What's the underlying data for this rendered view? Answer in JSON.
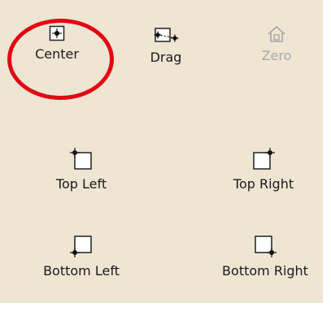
{
  "toolbar": {
    "center": {
      "label": "Center",
      "icon": "crosshair-box-icon"
    },
    "drag": {
      "label": "Drag",
      "icon": "drag-points-icon"
    },
    "zero": {
      "label": "Zero",
      "icon": "home-icon",
      "disabled": true
    }
  },
  "anchors": {
    "top_left": {
      "label": "Top Left",
      "icon": "anchor-top-left-icon"
    },
    "top_right": {
      "label": "Top Right",
      "icon": "anchor-top-right-icon"
    },
    "bottom_left": {
      "label": "Bottom Left",
      "icon": "anchor-bottom-left-icon"
    },
    "bottom_right": {
      "label": "Bottom Right",
      "icon": "anchor-bottom-right-icon"
    }
  },
  "colors": {
    "panel_background": "#efe5d3",
    "highlight": "#e30613",
    "disabled_text": "#a8a8a8"
  }
}
